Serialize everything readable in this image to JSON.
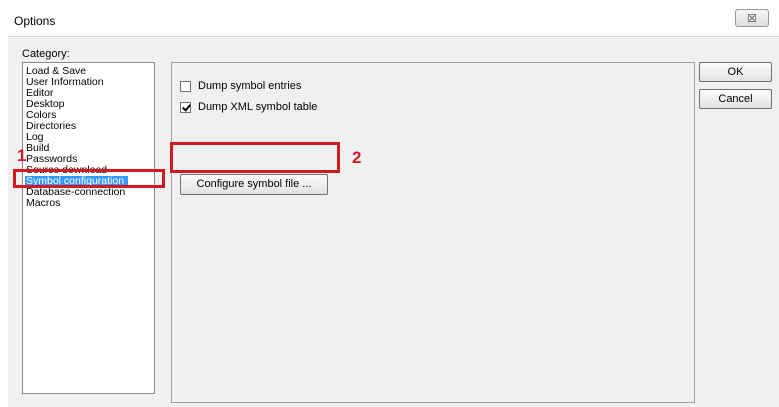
{
  "window": {
    "title": "Options",
    "close_glyph": "☒"
  },
  "category": {
    "label": "Category:",
    "items": [
      {
        "label": "Load & Save"
      },
      {
        "label": "User Information"
      },
      {
        "label": "Editor"
      },
      {
        "label": "Desktop"
      },
      {
        "label": "Colors"
      },
      {
        "label": "Directories"
      },
      {
        "label": "Log"
      },
      {
        "label": "Build"
      },
      {
        "label": "Passwords"
      },
      {
        "label": "Source download"
      },
      {
        "label": "Symbol configuration",
        "selected": true
      },
      {
        "label": "Database-connection"
      },
      {
        "label": "Macros"
      }
    ]
  },
  "symbol_panel": {
    "dump_entries": {
      "label": "Dump symbol entries",
      "checked": false
    },
    "dump_xml": {
      "label": "Dump XML symbol table",
      "checked": true
    },
    "configure_button": "Configure symbol file ..."
  },
  "buttons": {
    "ok": "OK",
    "cancel": "Cancel"
  },
  "annotations": {
    "marker_1": "1",
    "marker_2": "2",
    "color": "#d41820"
  }
}
